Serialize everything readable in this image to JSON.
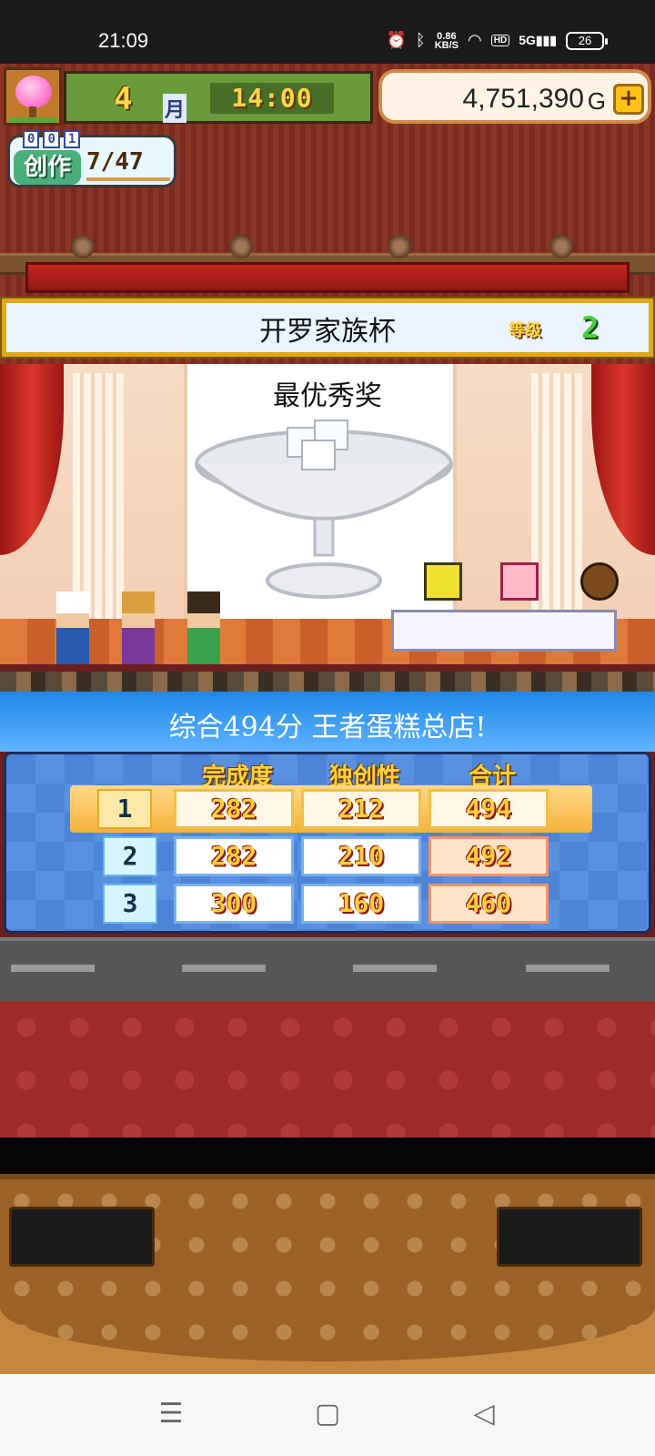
{
  "status_bar": {
    "time": "21:09",
    "speed_value": "0.86",
    "speed_unit": "KB/S",
    "hd": "HD",
    "network": "5G",
    "battery": "26"
  },
  "hud": {
    "month": "4",
    "month_unit": "月",
    "clock": "14:00",
    "money": "4,751,390",
    "money_unit": "G",
    "create_label": "创作",
    "create_counter": [
      "0",
      "0",
      "1"
    ],
    "create_progress": "7/47"
  },
  "contest": {
    "name": "开罗家族杯",
    "grade_label": "等级",
    "grade": "2"
  },
  "award": {
    "title": "最优秀奖"
  },
  "result": {
    "text": "综合494分 王者蛋糕总店!"
  },
  "scoreboard": {
    "headers": [
      "完成度",
      "独创性",
      "合计"
    ],
    "rows": [
      {
        "rank": "1",
        "completion": "282",
        "originality": "212",
        "total": "494"
      },
      {
        "rank": "2",
        "completion": "282",
        "originality": "210",
        "total": "492"
      },
      {
        "rank": "3",
        "completion": "300",
        "originality": "160",
        "total": "460"
      }
    ]
  },
  "nav": {
    "menu": "☰",
    "home": "▢",
    "back": "◁"
  },
  "colors": {
    "banner_blue": "#1f88e8",
    "score_yellow": "#ffce3a",
    "contest_border": "#e0a81a"
  }
}
